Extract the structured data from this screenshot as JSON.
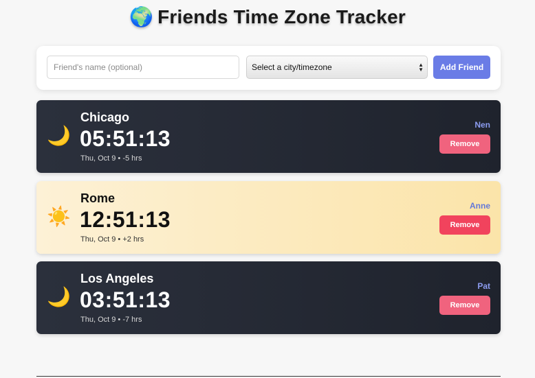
{
  "header": {
    "icon": "globe-emoji",
    "icon_glyph": "🌍",
    "title": "Friends Time Zone Tracker"
  },
  "controls": {
    "name_placeholder": "Friend's name (optional)",
    "name_value": "",
    "city_select_value": "Select a city/timezone",
    "add_button_label": "Add Friend"
  },
  "friends": [
    {
      "theme": "night",
      "icon": "crescent-moon-icon",
      "icon_glyph": "🌙",
      "city": "Chicago",
      "time": "05:51:13",
      "date": "Thu, Oct 9",
      "separator": "•",
      "offset": "-5 hrs",
      "friend_name": "Nen",
      "remove_label": "Remove"
    },
    {
      "theme": "day",
      "icon": "sun-icon",
      "icon_glyph": "☀️",
      "city": "Rome",
      "time": "12:51:13",
      "date": "Thu, Oct 9",
      "separator": "•",
      "offset": "+2 hrs",
      "friend_name": "Anne",
      "remove_label": "Remove"
    },
    {
      "theme": "night",
      "icon": "crescent-moon-icon",
      "icon_glyph": "🌙",
      "city": "Los Angeles",
      "time": "03:51:13",
      "date": "Thu, Oct 9",
      "separator": "•",
      "offset": "-7 hrs",
      "friend_name": "Pat",
      "remove_label": "Remove"
    }
  ],
  "colors": {
    "accent": "#6a7ce6",
    "night_card": "#252a35",
    "day_card": "#fce9bd",
    "remove": "#f1435d"
  }
}
